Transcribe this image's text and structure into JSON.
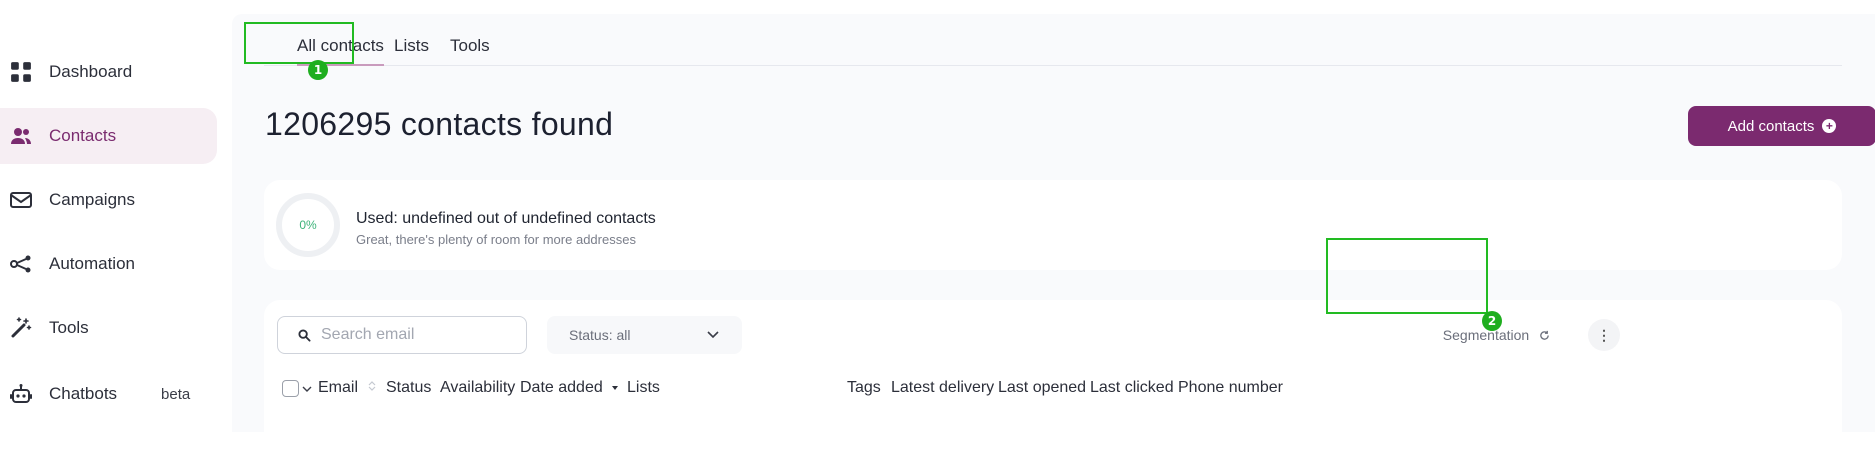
{
  "sidebar": {
    "items": [
      {
        "label": "Dashboard",
        "icon": "grid-icon",
        "active": false
      },
      {
        "label": "Contacts",
        "icon": "people-icon",
        "active": true
      },
      {
        "label": "Campaigns",
        "icon": "envelope-icon",
        "active": false
      },
      {
        "label": "Automation",
        "icon": "share-nodes-icon",
        "active": false
      },
      {
        "label": "Tools",
        "icon": "magic-wand-icon",
        "active": false
      },
      {
        "label": "Chatbots",
        "icon": "robot-icon",
        "active": false,
        "badge": "beta"
      }
    ]
  },
  "tabs": {
    "all_contacts": "All contacts",
    "lists": "Lists",
    "tools": "Tools",
    "annotation_1": "1",
    "annotation_2": "2"
  },
  "header": {
    "title": "1206295 contacts found",
    "add_button": "Add contacts"
  },
  "usage": {
    "percent": "0%",
    "title": "Used: undefined out of undefined contacts",
    "subtitle": "Great, there's plenty of room for more addresses"
  },
  "toolbar": {
    "search_placeholder": "Search email",
    "status_label": "Status: all",
    "segmentation_label": "Segmentation",
    "more_label": "⋮"
  },
  "table": {
    "columns": [
      "Email",
      "Status",
      "Availability",
      "Date added",
      "Lists",
      "Tags",
      "Latest delivery",
      "Last opened",
      "Last clicked",
      "Phone number"
    ]
  },
  "colors": {
    "accent": "#7b2a6f",
    "active_nav_bg": "#f6eef3",
    "highlight": "#22bb22"
  }
}
